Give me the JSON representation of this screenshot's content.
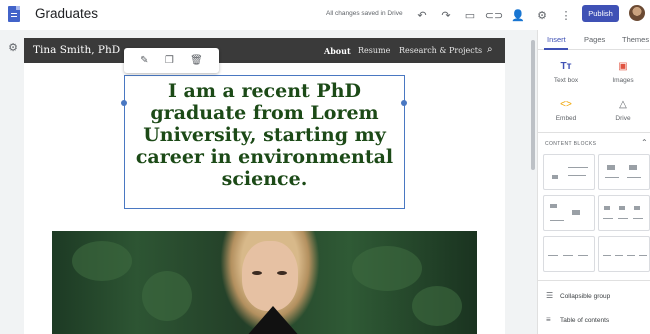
{
  "app": {
    "site_title": "Graduates",
    "saved_status": "All changes saved in Drive",
    "publish_label": "Publish"
  },
  "toolbar_icons": [
    "undo-icon",
    "redo-icon",
    "preview-icon",
    "link-icon",
    "share-icon",
    "settings-icon",
    "more-icon"
  ],
  "site": {
    "name": "Tina Smith, PhD",
    "nav": [
      "About",
      "Resume",
      "Research & Projects"
    ],
    "active_nav": "About",
    "headline": "I am a recent PhD graduate from Lorem University, starting my career in environmental science."
  },
  "colors": {
    "accent": "#3f51b5",
    "headline": "#1c4a17",
    "nav_bg": "#3a3a3a",
    "selection": "#4a78c2"
  },
  "panel": {
    "tabs": [
      "Insert",
      "Pages",
      "Themes"
    ],
    "active_tab": "Insert",
    "insert_items": [
      {
        "label": "Text box",
        "icon": "text-box-icon"
      },
      {
        "label": "Images",
        "icon": "image-icon"
      },
      {
        "label": "Embed",
        "icon": "embed-icon"
      },
      {
        "label": "Drive",
        "icon": "drive-icon"
      }
    ],
    "content_blocks_title": "CONTENT BLOCKS",
    "list_items": [
      {
        "label": "Collapsible group",
        "icon": "collapsible-group-icon"
      },
      {
        "label": "Table of contents",
        "icon": "table-of-contents-icon"
      }
    ]
  }
}
